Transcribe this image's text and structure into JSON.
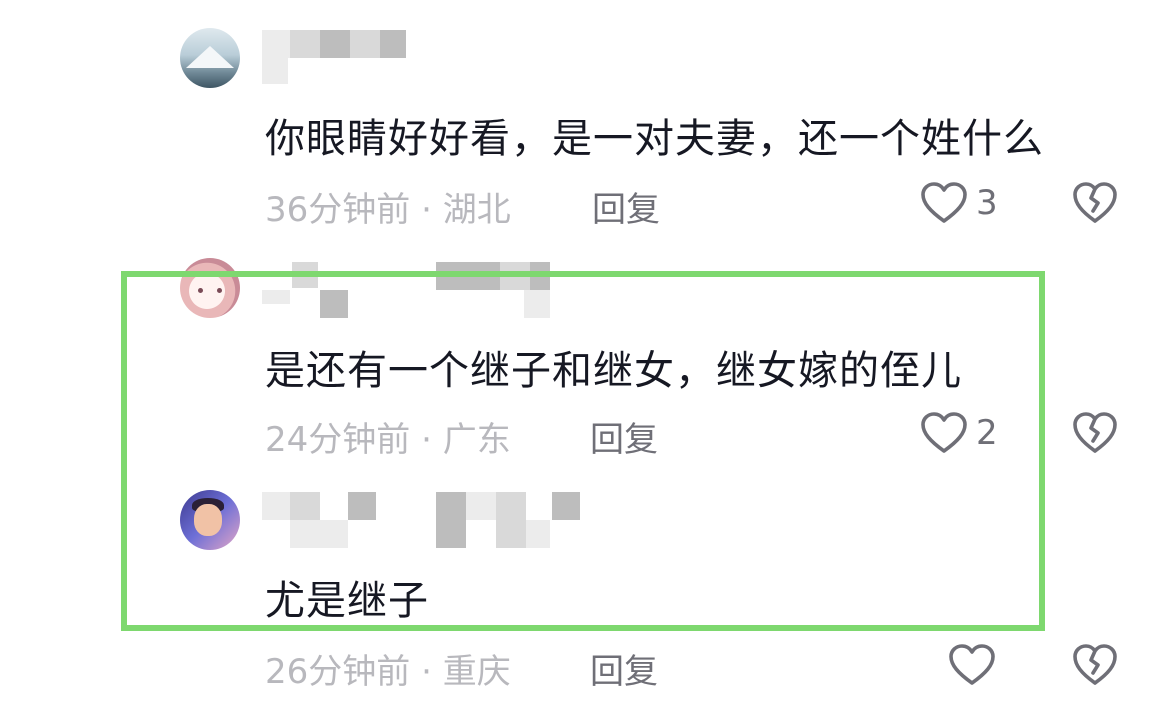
{
  "comments": [
    {
      "text": "你眼睛好好看，是一对夫妻，还一个姓什么",
      "time": "36分钟前",
      "separator": "·",
      "location": "湖北",
      "reply_label": "回复",
      "like_count": "3"
    },
    {
      "text": "是还有一个继子和继女，继女嫁的侄儿",
      "time": "24分钟前",
      "separator": "·",
      "location": "广东",
      "reply_label": "回复",
      "like_count": "2"
    },
    {
      "text": "尤是继子",
      "time": "26分钟前",
      "separator": "·",
      "location": "重庆",
      "reply_label": "回复",
      "like_count": ""
    }
  ],
  "colors": {
    "highlight_border": "#7ed86f",
    "text_primary": "#161823",
    "text_meta": "#b8b8bd",
    "text_action": "#6f6f77"
  },
  "icons": {
    "like": "heart-outline-icon",
    "dislike": "broken-heart-icon"
  }
}
